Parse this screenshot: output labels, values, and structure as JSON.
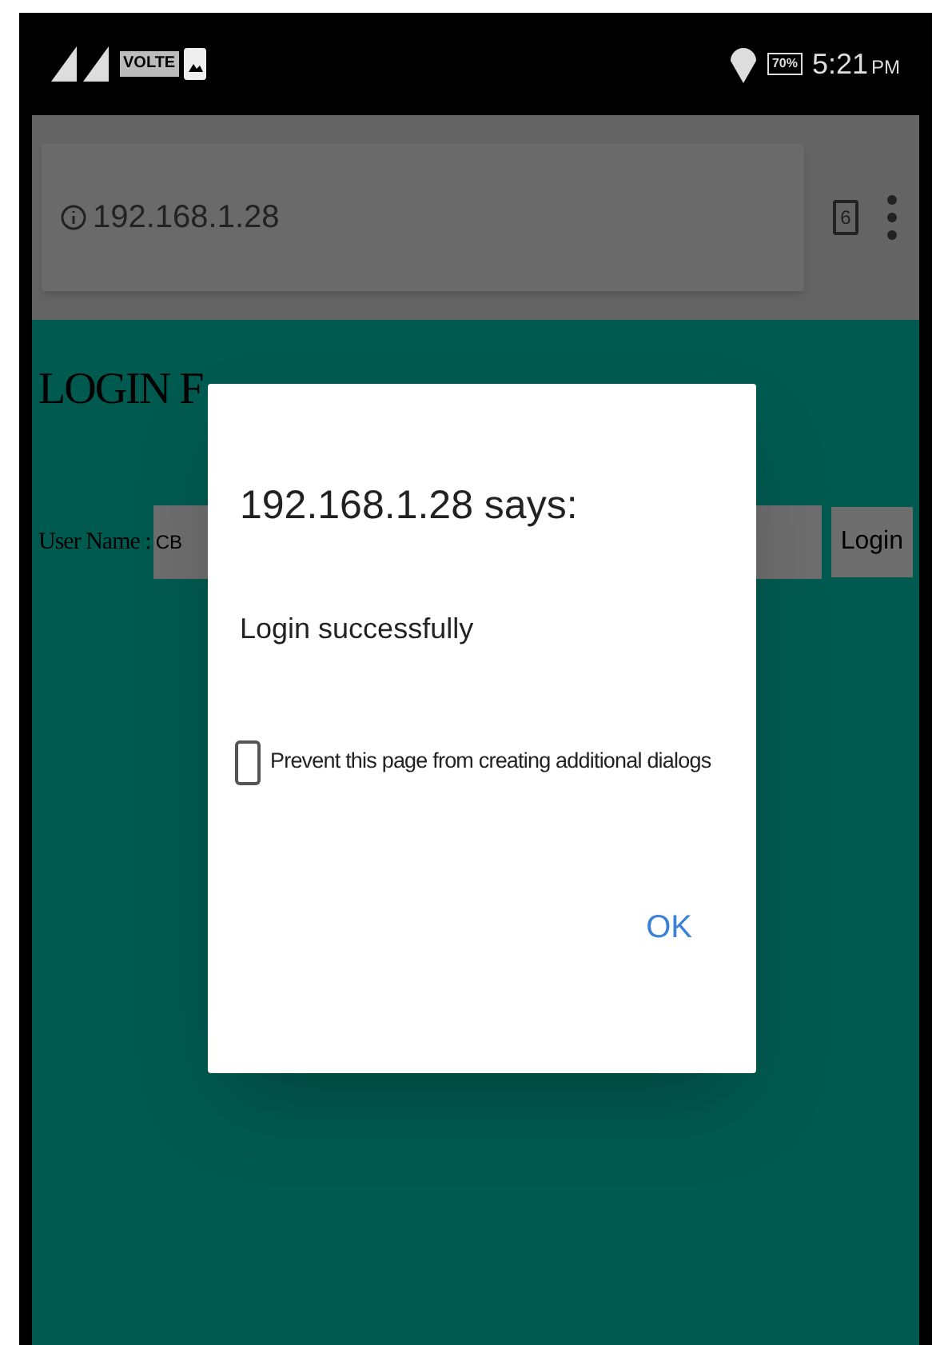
{
  "status_bar": {
    "network_badge": "VOLTE",
    "battery": "70%",
    "time": "5:21",
    "time_suffix": "PM"
  },
  "browser": {
    "url": "192.168.1.28",
    "tab_count": "6"
  },
  "page": {
    "heading": "LOGIN F",
    "username_label": "User Name :",
    "username_value": "CB",
    "login_button": "Login"
  },
  "dialog": {
    "title": "192.168.1.28 says:",
    "message": "Login successfully",
    "checkbox": {
      "label": "Prevent this page from creating additional dialogs",
      "checked": false
    },
    "ok_button": "OK"
  }
}
